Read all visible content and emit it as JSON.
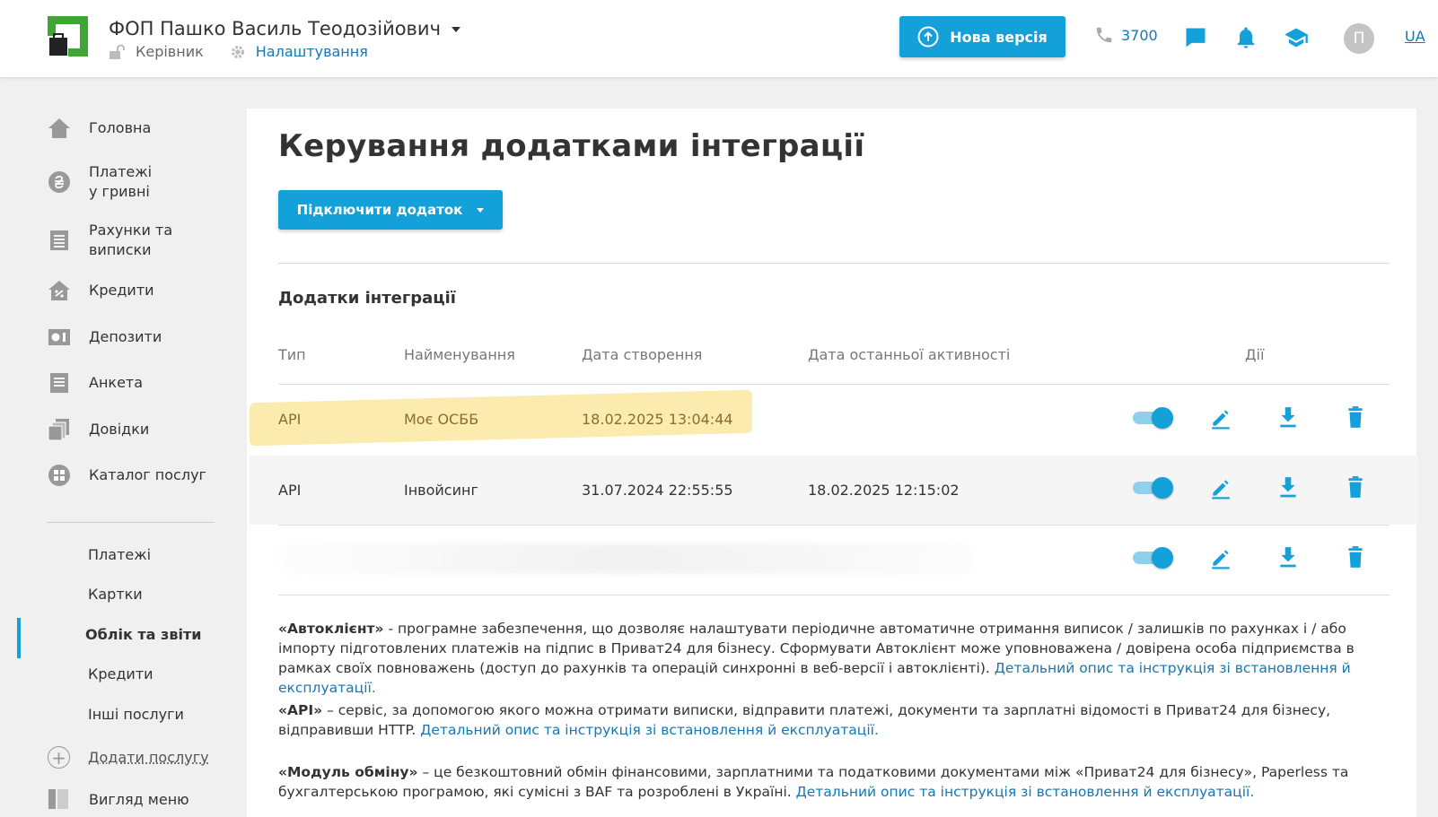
{
  "header": {
    "company": "ФОП Пашко Василь Теодозійович",
    "role": "Керівник",
    "settings": "Налаштування",
    "new_version": "Нова версія",
    "phone": "3700",
    "avatar_letter": "П",
    "lang": "UA"
  },
  "sidebar": {
    "items": [
      {
        "label": "Головна",
        "icon": "home-icon"
      },
      {
        "label": "Платежі\nу гривні",
        "icon": "hryvnia-icon"
      },
      {
        "label": "Рахунки та\nвиписки",
        "icon": "statement-icon"
      },
      {
        "label": "Кредити",
        "icon": "credit-house-icon"
      },
      {
        "label": "Депозити",
        "icon": "deposit-icon"
      },
      {
        "label": "Анкета",
        "icon": "form-icon"
      },
      {
        "label": "Довідки",
        "icon": "documents-icon"
      },
      {
        "label": "Каталог послуг",
        "icon": "catalog-icon"
      }
    ],
    "sub_items": [
      "Платежі",
      "Картки",
      "Облік та звіти",
      "Кредити",
      "Інші послуги"
    ],
    "active_sub": "Облік та звіти",
    "add_service": "Додати послугу",
    "view_menu": "Вигляд меню"
  },
  "main": {
    "title": "Керування додатками інтеграції",
    "connect_button": "Підключити додаток",
    "section_title": "Додатки інтеграції",
    "columns": [
      "Тип",
      "Найменування",
      "Дата створення",
      "Дата останньої активності",
      "Дії"
    ],
    "rows": [
      {
        "type": "API",
        "name": "Моє ОСББ",
        "created": "18.02.2025 13:04:44",
        "last_activity": "",
        "enabled": true
      },
      {
        "type": "API",
        "name": "Інвойсинг",
        "created": "31.07.2024 22:55:55",
        "last_activity": "18.02.2025 12:15:02",
        "enabled": true
      },
      {
        "type": "",
        "name": "",
        "created": "",
        "last_activity": "",
        "enabled": true
      }
    ]
  },
  "descriptions": {
    "autoclient_title": "«Автоклієнт»",
    "autoclient_text": " - програмне забезпечення, що дозволяє налаштувати періодичне автоматичне отримання виписок / залишків по рахунках і / або імпорту підготовлених платежів на підпис в Приват24 для бізнесу. Сформувати Автоклієнт може уповноважена / довірена особа підприємства в рамках своїх повноважень (доступ до рахунків та операцій синхронні в веб-версії і автоклієнті). ",
    "autoclient_link": "Детальний опис та інструкція зі встановлення й експлуатації.",
    "api_title": "«API»",
    "api_text": " – сервіс, за допомогою якого можна отримати виписки, відправити платежі, документи та зарплатні відомості в Приват24 для бізнесу, відправивши HTTP. ",
    "api_link": "Детальний опис та інструкція зі встановлення й експлуатації.",
    "exchange_title": "«Модуль обміну»",
    "exchange_text": " – це безкоштовний обмін фінансовими, зарплатними та податковими документами між «Приват24 для бізнесу», Paperless та бухгалтерською програмою, які сумісні з BAF та розроблені в Україні. ",
    "exchange_link": "Детальний опис та інструкція зі встановлення й експлуатації."
  },
  "colors": {
    "accent": "#14a0d8",
    "link": "#1677b3",
    "brand_green": "#3fa535",
    "highlight": "#fbe69a"
  }
}
